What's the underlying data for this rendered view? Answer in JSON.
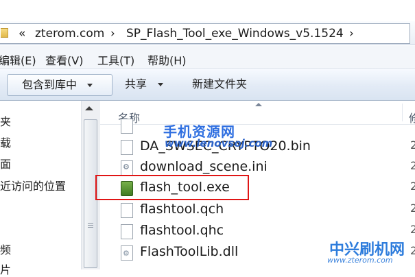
{
  "address": {
    "prefix": "«",
    "segments": [
      "zterom.com",
      "SP_Flash_Tool_exe_Windows_v5.1524"
    ]
  },
  "menu": [
    "编辑(E)",
    "查看(V)",
    "工具(T)",
    "帮助(H)"
  ],
  "toolbar": {
    "include_library": "包含到库中",
    "share": "共享",
    "new_folder": "新建文件夹"
  },
  "nav": [
    "夹",
    "载",
    "面",
    "近访问的位置",
    "频",
    "片"
  ],
  "columns": {
    "name": "名称",
    "date": "修"
  },
  "files": [
    {
      "name": "DA_SWSEC_CRYPTO20.bin",
      "icon": "file-icon",
      "date": "2"
    },
    {
      "name": "download_scene.ini",
      "icon": "settings-file-icon",
      "date": "2"
    },
    {
      "name": "flash_tool.exe",
      "icon": "android-exe-icon",
      "date": "2"
    },
    {
      "name": "flashtool.qch",
      "icon": "file-icon",
      "date": "2"
    },
    {
      "name": "flashtool.qhc",
      "icon": "file-icon",
      "date": "2"
    },
    {
      "name": "FlashToolLib.dll",
      "icon": "dll-file-icon",
      "date": "2"
    }
  ],
  "watermarks": {
    "top": "手机资源网",
    "top_url": "www.lenovsoj.com",
    "bottom": "中兴刷机网",
    "bottom_url": "www.zterom.com"
  },
  "colors": {
    "highlight": "#e01515",
    "watermark": "#2d7cdc"
  }
}
